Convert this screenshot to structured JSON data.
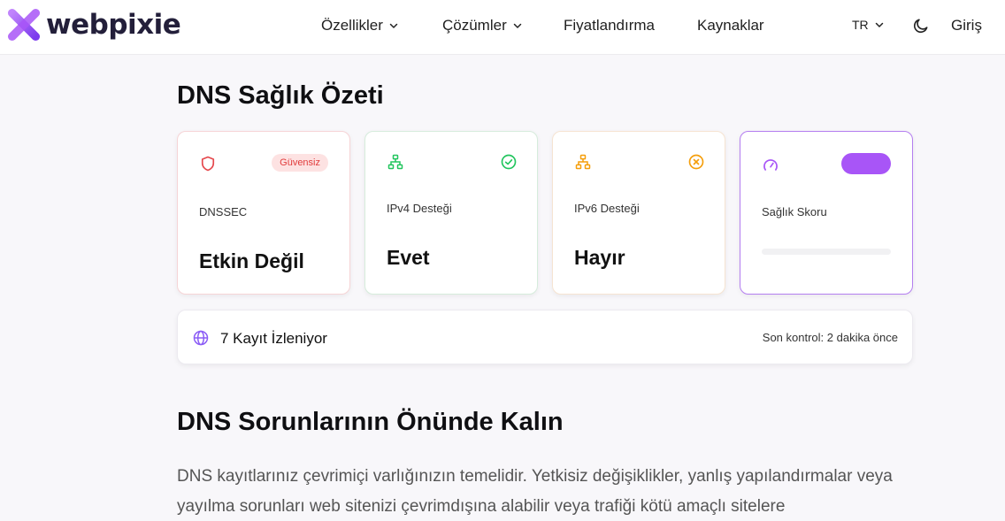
{
  "brand": {
    "name": "webpixie",
    "accent": "#a855f7"
  },
  "nav": {
    "items": [
      {
        "label": "Özellikler",
        "has_dropdown": true
      },
      {
        "label": "Çözümler",
        "has_dropdown": true
      },
      {
        "label": "Fiyatlandırma",
        "has_dropdown": false
      },
      {
        "label": "Kaynaklar",
        "has_dropdown": false
      }
    ],
    "language": "TR",
    "login": "Giriş"
  },
  "summary": {
    "title": "DNS Sağlık Özeti",
    "cards": [
      {
        "label": "DNSSEC",
        "value": "Etkin Değil",
        "badge": "Güvensiz",
        "icon": "shield-icon",
        "color": "#e5484d"
      },
      {
        "label": "IPv4 Desteği",
        "value": "Evet",
        "icon": "network-icon",
        "status_icon": "check-circle-icon",
        "color": "#22c55e"
      },
      {
        "label": "IPv6 Desteği",
        "value": "Hayır",
        "icon": "network-icon",
        "status_icon": "x-circle-icon",
        "color": "#f59e0b"
      },
      {
        "label": "Sağlık Skoru",
        "icon": "gauge-icon",
        "color": "#a855f7"
      }
    ],
    "tracker": {
      "label": "7 Kayıt İzleniyor",
      "last_check": "Son kontrol: 2 dakika önce"
    }
  },
  "section": {
    "title": "DNS Sorunlarının Önünde Kalın",
    "body": "DNS kayıtlarınız çevrimiçi varlığınızın temelidir. Yetkisiz değişiklikler, yanlış yapılandırmalar veya yayılma sorunları web sitenizi çevrimdışına alabilir veya trafiği kötü amaçlı sitelere"
  }
}
